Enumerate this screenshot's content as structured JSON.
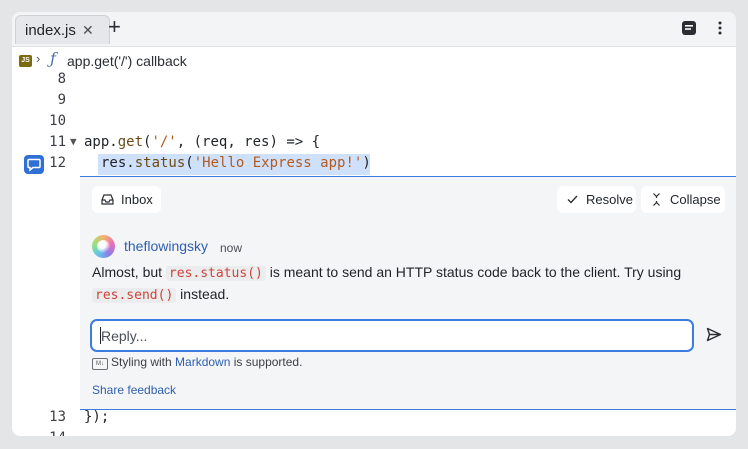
{
  "tabs": [
    {
      "label": "index.js",
      "close_icon": "close-icon"
    }
  ],
  "toolbar": {
    "new_tab_icon": "plus-icon",
    "outline_icon": "outline-icon",
    "menu_icon": "more-vertical-icon"
  },
  "breadcrumb": {
    "file_badge": "JS",
    "symbol_icon": "function-icon",
    "symbol": "app.get('/') callback"
  },
  "code_lines": [
    {
      "num": "8"
    },
    {
      "num": "9"
    },
    {
      "num": "10"
    },
    {
      "num": "11",
      "t1": "app.",
      "t2": "get",
      "t3": "(",
      "t4": "'/'",
      "t5": ", (req, res) => {"
    },
    {
      "num": "12",
      "t1": "res.",
      "t2": "status",
      "t3": "(",
      "t4": "'Hello Express app!'",
      "t5": ")"
    },
    {
      "num": "13",
      "text": "});"
    },
    {
      "num": "14"
    }
  ],
  "thread": {
    "inbox_label": "Inbox",
    "resolve_label": "Resolve",
    "collapse_label": "Collapse",
    "comment": {
      "author": "theflowingsky",
      "time": "now",
      "parts": [
        "Almost, but ",
        "res.status()",
        " is meant to send an HTTP status code back to the client. Try using ",
        "res.send()",
        " instead."
      ]
    },
    "reply_placeholder": "Reply...",
    "markdown_badge": "M↓",
    "markdown_prefix": "Styling with ",
    "markdown_link": "Markdown",
    "markdown_suffix": " is supported.",
    "share_feedback": "Share feedback"
  },
  "colors": {
    "accent": "#3d7be0",
    "inline_code": "#d0443a",
    "link": "#2f5fb0",
    "string": "#b35a1f"
  }
}
